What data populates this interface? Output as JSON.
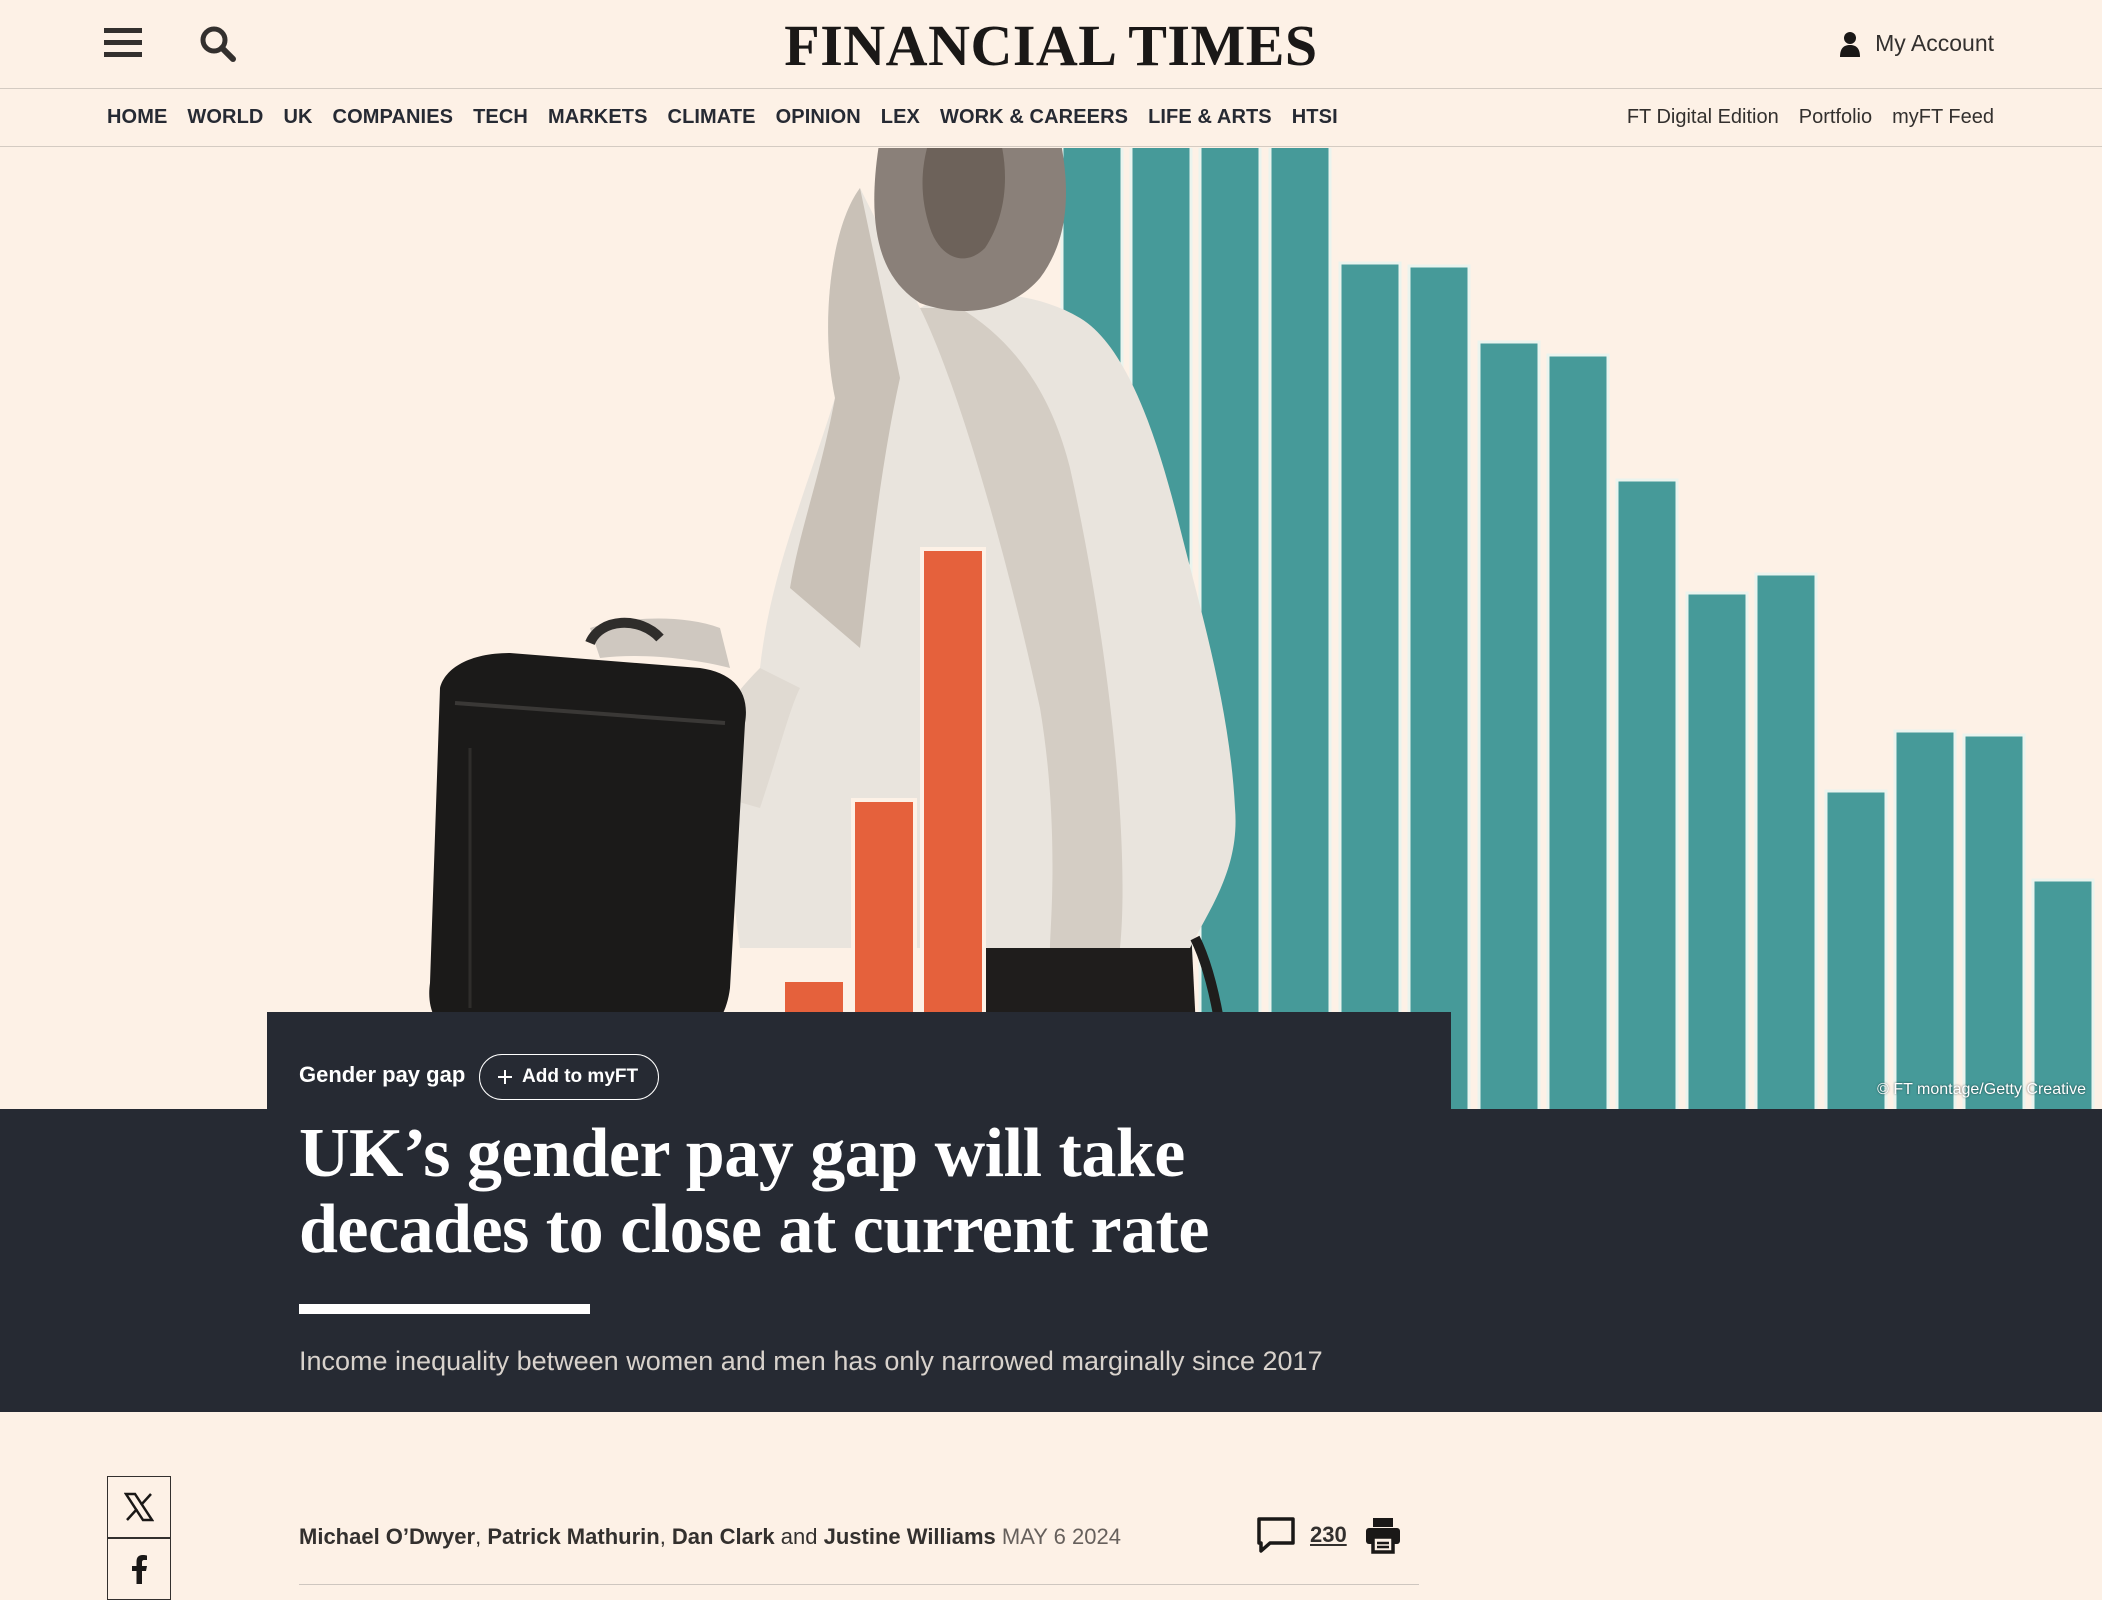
{
  "header": {
    "masthead": "FINANCIAL TIMES",
    "account_label": "My Account",
    "menu_icon": "hamburger-icon",
    "search_icon": "search-icon",
    "account_icon": "user-icon"
  },
  "nav": {
    "sections": [
      "HOME",
      "WORLD",
      "UK",
      "COMPANIES",
      "TECH",
      "MARKETS",
      "CLIMATE",
      "OPINION",
      "LEX",
      "WORK & CAREERS",
      "LIFE & ARTS",
      "HTSI"
    ],
    "tools": [
      "FT Digital Edition",
      "Portfolio",
      "myFT Feed"
    ]
  },
  "hero": {
    "credit": "© FT montage/Getty Creative",
    "accent_colors": {
      "teal": "#469a99",
      "orange": "#e5613c"
    }
  },
  "article": {
    "topic": "Gender pay gap",
    "add_myft_label": "Add to myFT",
    "headline_line1": "UK’s gender pay gap will take",
    "headline_line2": "decades to close at current rate",
    "standfirst": "Income inequality between women and men has only narrowed marginally since 2017",
    "authors": [
      "Michael O’Dwyer",
      "Patrick Mathurin",
      "Dan Clark",
      "Justine Williams"
    ],
    "byline_joiner": "and",
    "date": "MAY 6 2024",
    "comment_count": "230"
  },
  "share": {
    "icons": [
      "x-icon",
      "facebook-icon"
    ]
  },
  "colors": {
    "page_background": "#fdf1e6",
    "dark_panel": "#262a33"
  }
}
